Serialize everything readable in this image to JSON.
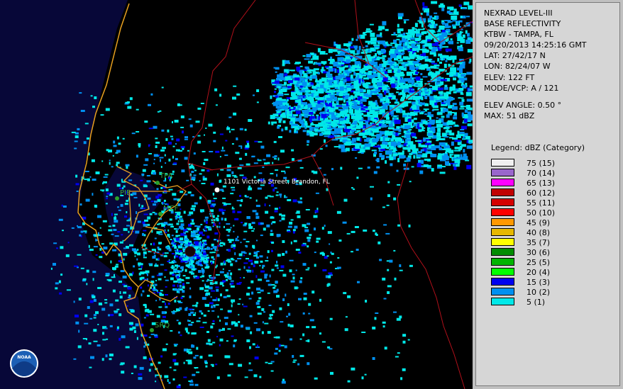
{
  "info": {
    "product": "NEXRAD LEVEL-III",
    "type": "BASE REFLECTIVITY",
    "station": "KTBW - TAMPA, FL",
    "datetime": "09/20/2013 14:25:16 GMT",
    "lat": "LAT: 27/42/17 N",
    "lon": "LON: 82/24/07 W",
    "elev": "ELEV: 122 FT",
    "mode": "MODE/VCP: A / 121",
    "elev_angle": "ELEV ANGLE: 0.50 °",
    "max": "MAX: 51 dBZ"
  },
  "legend": {
    "title": "Legend: dBZ (Category)",
    "items": [
      {
        "label": "75  (15)",
        "color": "#f0f0f0"
      },
      {
        "label": "70  (14)",
        "color": "#9966cc"
      },
      {
        "label": "65  (13)",
        "color": "#ff00ff"
      },
      {
        "label": "60  (12)",
        "color": "#c00000"
      },
      {
        "label": "55  (11)",
        "color": "#d40000"
      },
      {
        "label": "50  (10)",
        "color": "#ff0000"
      },
      {
        "label": "45  (9)",
        "color": "#ff9900"
      },
      {
        "label": "40  (8)",
        "color": "#e6b800"
      },
      {
        "label": "35  (7)",
        "color": "#ffff00"
      },
      {
        "label": "30  (6)",
        "color": "#008c00"
      },
      {
        "label": "25  (5)",
        "color": "#00b400"
      },
      {
        "label": "20  (4)",
        "color": "#00ff00"
      },
      {
        "label": "15  (3)",
        "color": "#0000f0"
      },
      {
        "label": "10  (2)",
        "color": "#0090f0"
      },
      {
        "label": "5  (1)",
        "color": "#00e8e8"
      }
    ]
  },
  "map": {
    "address": "1101 Victoria Street, Brandon, FL",
    "cities": [
      "TPA",
      "PIE",
      "MCF",
      "SRQ"
    ],
    "logo_text": "NOAA"
  }
}
